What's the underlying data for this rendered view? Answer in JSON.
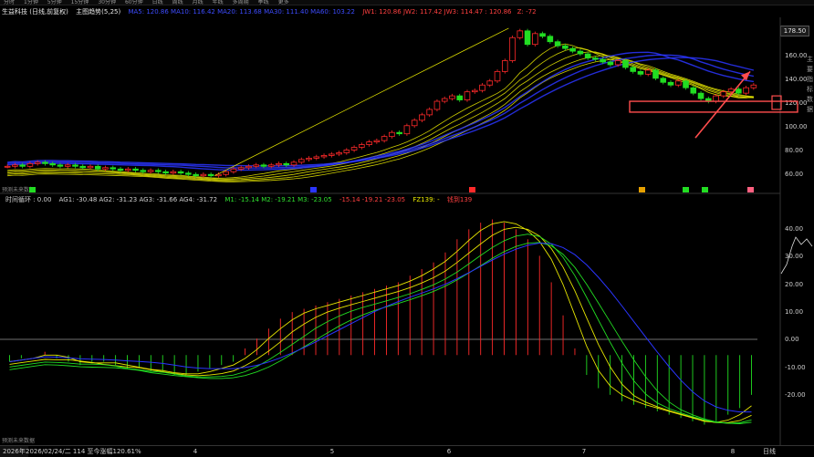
{
  "toolbar": {
    "items": [
      "分时",
      "1分钟",
      "5分钟",
      "15分钟",
      "30分钟",
      "60分钟",
      "日线",
      "周线",
      "月线",
      "年线",
      "多周期",
      "季线",
      "更多"
    ]
  },
  "header": {
    "title": "生益科技 (日线,前复权)",
    "indicator": "主图趋势(5,25)",
    "ma_line": "MA5: 120.86  MA10: 116.42  MA20: 113.68  MA30: 111.40  MA60: 103.22",
    "jw": "JW1: 120.86  JW2: 117.42  JW3: 114.47  : 120.86",
    "z": "Z: -72"
  },
  "sub_header": {
    "name": "时间循环 : 0.00",
    "ag": "AG1: -30.48  AG2: -31.23  AG3: -31.66  AG4: -31.72",
    "m": "M1: -15.14  M2: -19.21  M3: -23.05",
    "r": "-15.14  -19.21  -23.05",
    "fz": "FZ139: -",
    "extra": "钱到139"
  },
  "price_axis": {
    "current_price": "178.50",
    "ticks": [
      "160.00",
      "140.00",
      "120.00",
      "100.00",
      "80.00",
      "60.00"
    ]
  },
  "osc_axis": {
    "ticks": [
      "40.00",
      "30.00",
      "20.00",
      "10.00",
      "0.00",
      "-10.00",
      "-20.00"
    ]
  },
  "sidebar_text": "主要指标数据",
  "footer": {
    "year": "2026年",
    "date_info": "2026/02/24/二 114  至今涨幅120.61%",
    "x_labels": [
      "4",
      "5",
      "6",
      "7",
      "8"
    ],
    "right": "日线"
  },
  "forecast_label": "预测未来数据",
  "colors": {
    "up": "#ff2a2a",
    "down": "#22dd22",
    "ma_blue": "#2a35ff",
    "ma_yellow": "#e6e600",
    "box": "#ff4d4d"
  },
  "chart_data": [
    {
      "type": "candlestick",
      "title": "生益科技 (日线,前复权)",
      "ylim": [
        50,
        180
      ],
      "yticks": [
        60,
        80,
        100,
        120,
        140,
        160
      ],
      "current_price": 178.5,
      "closes": [
        70,
        71,
        70,
        72,
        73,
        72,
        71,
        70,
        71,
        70,
        69,
        70,
        68,
        69,
        68,
        67,
        68,
        67,
        66,
        67,
        66,
        65,
        66,
        65,
        64,
        63,
        64,
        63,
        64,
        66,
        68,
        69,
        70,
        71,
        70,
        71,
        72,
        71,
        73,
        75,
        76,
        77,
        78,
        79,
        80,
        82,
        84,
        86,
        88,
        89,
        92,
        95,
        94,
        100,
        104,
        108,
        112,
        118,
        120,
        122,
        119,
        125,
        126,
        130,
        133,
        140,
        148,
        165,
        170,
        160,
        168,
        166,
        162,
        159,
        157,
        155,
        153,
        150,
        149,
        147,
        145,
        148,
        143,
        140,
        138,
        141,
        135,
        132,
        130,
        133,
        128,
        124,
        120,
        118,
        122,
        125,
        127,
        124,
        128,
        130
      ]
    },
    {
      "type": "bar",
      "title": "时间循环",
      "ylim": [
        -25,
        45
      ],
      "yticks": [
        40,
        30,
        20,
        10,
        0,
        -10,
        -20
      ],
      "values": [
        -2,
        -1,
        0,
        1,
        -1,
        -2,
        -3,
        -2,
        -2,
        -3,
        -4,
        -4,
        -5,
        -5,
        -6,
        -6,
        -5,
        -4,
        -3,
        -2,
        2,
        5,
        8,
        11,
        13,
        14,
        15,
        16,
        17,
        18,
        19,
        20,
        21,
        22,
        24,
        26,
        28,
        31,
        35,
        38,
        40,
        41,
        40,
        38,
        35,
        30,
        22,
        12,
        2,
        -6,
        -10,
        -12,
        -14,
        -15,
        -16,
        -17,
        -18,
        -19,
        -20,
        -21,
        -20,
        -18,
        -16,
        -12
      ]
    }
  ]
}
